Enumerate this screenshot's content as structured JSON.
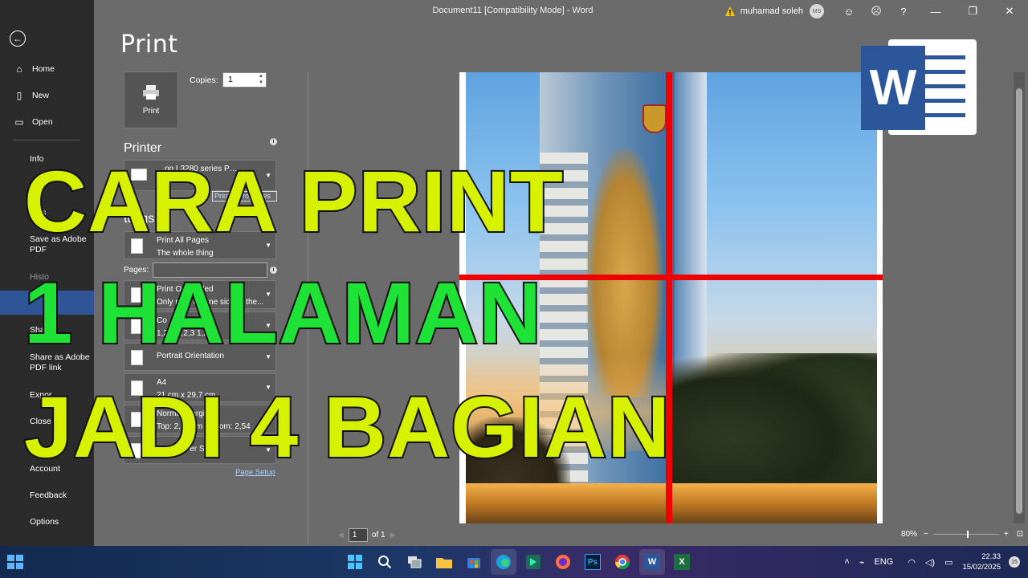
{
  "title_bar": {
    "document_title": "Document11 [Compatibility Mode]  -  Word",
    "user_name": "muhamad soleh",
    "user_initials": "MS",
    "icons": [
      "warning-icon",
      "smiley-icon",
      "frown-icon",
      "help-icon",
      "minimize-icon",
      "restore-icon",
      "close-icon"
    ],
    "help_label": "?",
    "minimize_label": "—",
    "restore_label": "❐",
    "close_label": "✕"
  },
  "nav": {
    "home": "Home",
    "new": "New",
    "open": "Open",
    "info": "Info",
    "save_as": "e As",
    "save_as_adobe_pdf": "Save as Adobe PDF",
    "history": "Histo",
    "share": "Sha",
    "share_adobe": "Share as Adobe PDF link",
    "export": "Expor",
    "close": "Close",
    "account": "Account",
    "feedback": "Feedback",
    "options": "Options"
  },
  "print_panel": {
    "heading": "Print",
    "print_button": "Print",
    "copies_label": "Copies:",
    "copies_value": "1",
    "printer_label": "Printer",
    "printer_name": "…on L3280 series P…",
    "printer_status": "dy",
    "printer_properties": "Printer Properties",
    "settings_label": "ttings",
    "print_all_pages": "Print All Pages",
    "the_whole_thing": "The whole thing",
    "pages_label": "Pages:",
    "one_sided": "Print One Sided",
    "one_sided_sub": "Only print on one side of the...",
    "collated": "Co",
    "collated_sub": "1,2,3  1,2,3  1,2,3",
    "orientation": "Portrait Orientation",
    "paper_size": "A4",
    "paper_size_sub": "21 cm x 29,7 cm",
    "margins": "Normal Margins",
    "margins_sub": "Top: 2,54 cm Bottom: 2,54",
    "pages_per_sheet": "1 Page Per Sheet",
    "page_setup_link": "Page Setup"
  },
  "preview": {
    "page_number": "1",
    "page_of": "of 1",
    "zoom": "80%",
    "zoom_minus": "−",
    "zoom_plus": "+"
  },
  "word_logo": {
    "letter": "W"
  },
  "overlay": {
    "line1": "CARA PRINT",
    "line2": "1 HALAMAN",
    "line3": "JADI 4 BAGIAN",
    "colors": {
      "yellow": "#d7f200",
      "green": "#1ee336",
      "red_line": "#f00000"
    }
  },
  "taskbar": {
    "apps": [
      "windows-start-icon",
      "search-icon",
      "task-view-icon",
      "file-explorer-icon",
      "store-icon",
      "edge-icon",
      "filmora-icon",
      "firefox-icon",
      "photoshop-icon",
      "chrome-icon",
      "word-icon",
      "excel-icon"
    ],
    "ps_label": "Ps",
    "word_label": "W",
    "excel_label": "X",
    "language": "ENG",
    "time": "22.33",
    "date": "15/02/2025",
    "notifications": "15"
  }
}
